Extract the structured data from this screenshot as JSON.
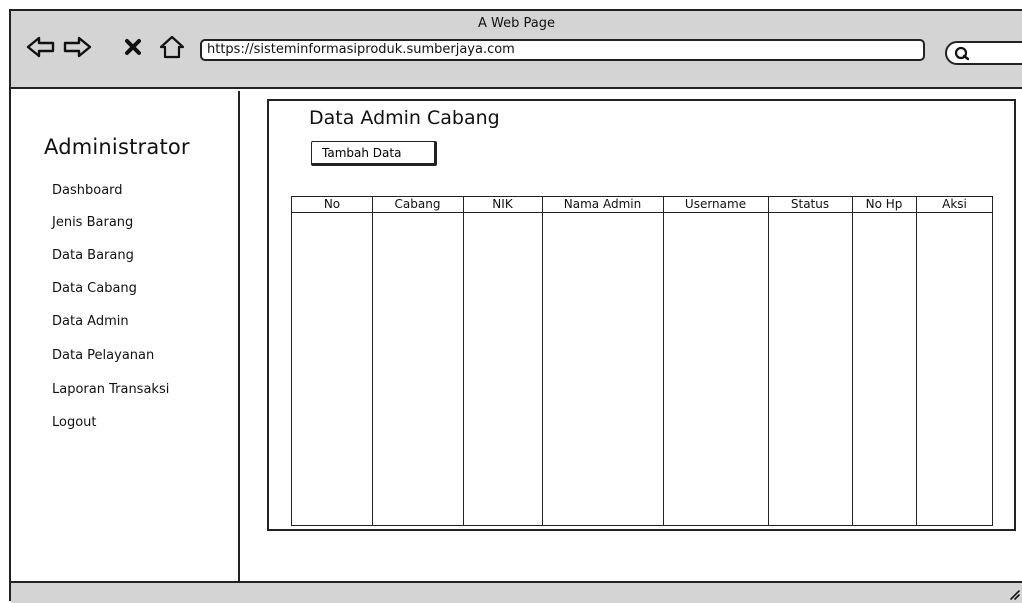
{
  "browser": {
    "title": "A Web Page",
    "url": "https://sisteminformasiproduk.sumberjaya.com",
    "icons": [
      "back-arrow-icon",
      "forward-arrow-icon",
      "close-x-icon",
      "home-icon",
      "search-icon"
    ]
  },
  "sidebar": {
    "title": "Administrator",
    "items": [
      {
        "label": "Dashboard"
      },
      {
        "label": "Jenis Barang"
      },
      {
        "label": "Data Barang"
      },
      {
        "label": "Data Cabang"
      },
      {
        "label": "Data Admin"
      },
      {
        "label": "Data Pelayanan"
      },
      {
        "label": "Laporan Transaksi"
      },
      {
        "label": "Logout"
      }
    ]
  },
  "main": {
    "title": "Data Admin Cabang",
    "add_button_label": "Tambah Data",
    "table": {
      "columns": [
        "No",
        "Cabang",
        "NIK",
        "Nama Admin",
        "Username",
        "Status",
        "No Hp",
        "Aksi"
      ],
      "rows": []
    }
  }
}
